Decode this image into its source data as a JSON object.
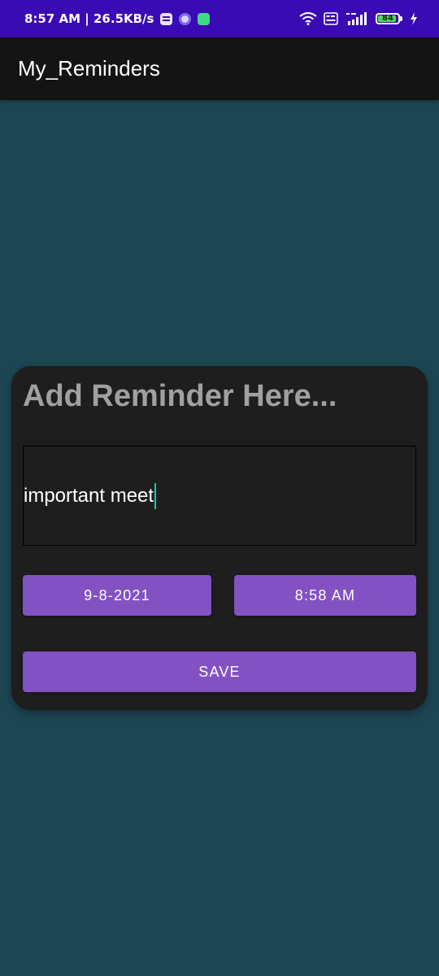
{
  "status_bar": {
    "time_speed": "8:57 AM | 26.5KB/s",
    "notification_icons": [
      "message-icon",
      "circle-app-icon",
      "android-icon"
    ],
    "network_label": "4G+",
    "volte_label": "Vo LTE",
    "battery_level": "84",
    "charging": true
  },
  "app_bar": {
    "title": "My_Reminders"
  },
  "card": {
    "heading": "Add Reminder Here...",
    "reminder_input": {
      "value": "important meet",
      "placeholder": ""
    },
    "date_button_label": "9-8-2021",
    "time_button_label": "8:58 AM",
    "save_button_label": "SAVE"
  },
  "colors": {
    "status_bar": "#3a0ab4",
    "app_bar": "#141414",
    "background": "#1d4654",
    "card": "#1e1e1e",
    "button": "#8251c2",
    "cursor": "#19c9b0"
  }
}
